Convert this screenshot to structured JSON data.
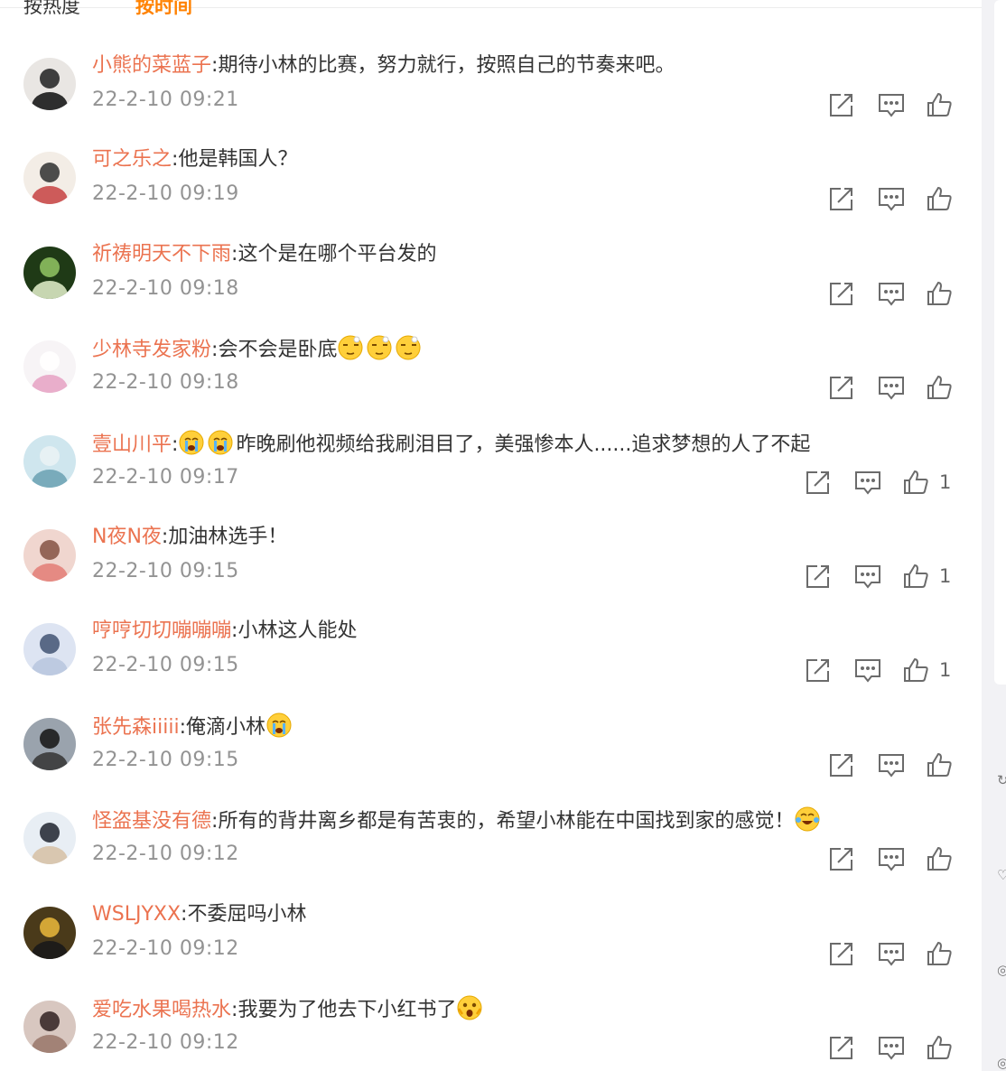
{
  "sort": {
    "hot_label": "按热度",
    "time_label": "按时间"
  },
  "comments": [
    {
      "user": "小熊的菜蓝子",
      "text": "期待小林的比赛，努力就行，按照自己的节奏来吧。",
      "emojis": [],
      "time": "22-2-10 09:21",
      "likes": ""
    },
    {
      "user": "可之乐之",
      "text": "他是韩国人？",
      "emojis": [],
      "time": "22-2-10 09:19",
      "likes": ""
    },
    {
      "user": "祈祷明天不下雨",
      "text": "这个是在哪个平台发的",
      "emojis": [],
      "time": "22-2-10 09:18",
      "likes": ""
    },
    {
      "user": "少林寺发家粉",
      "text": "会不会是卧底",
      "emojis": [
        "dizzy-face",
        "dizzy-face",
        "dizzy-face"
      ],
      "time": "22-2-10 09:18",
      "likes": ""
    },
    {
      "user": "壹山川平",
      "text_before": "",
      "emojis_before": [
        "crying-face",
        "crying-face"
      ],
      "text": "昨晚刷他视频给我刷泪目了，美强惨本人......追求梦想的人了不起",
      "emojis": [],
      "time": "22-2-10 09:17",
      "likes": "1"
    },
    {
      "user": "N夜N夜",
      "text": "加油林选手！",
      "emojis": [],
      "time": "22-2-10 09:15",
      "likes": "1"
    },
    {
      "user": "哼哼切切嘣嘣嘣",
      "text": "小林这人能处",
      "emojis": [],
      "time": "22-2-10 09:15",
      "likes": "1"
    },
    {
      "user": "张先森iiiii",
      "text": "俺滴小林",
      "emojis": [
        "crying-face"
      ],
      "time": "22-2-10 09:15",
      "likes": ""
    },
    {
      "user": "怪盗基没有德",
      "text": "所有的背井离乡都是有苦衷的，希望小林能在中国找到家的感觉！",
      "emojis": [
        "tears-of-joy-face"
      ],
      "time": "22-2-10 09:12",
      "likes": ""
    },
    {
      "user": "WSLJYXX",
      "text": "不委屈吗小林",
      "emojis": [],
      "time": "22-2-10 09:12",
      "likes": ""
    },
    {
      "user": "爱吃水果喝热水",
      "text": "我要为了他去下小红书了",
      "emojis": [
        "screaming-face"
      ],
      "time": "22-2-10 09:12",
      "likes": ""
    }
  ],
  "icons": {
    "share": "share-icon",
    "comment": "comment-icon",
    "like": "like-icon"
  },
  "colors": {
    "username": "#eb7350",
    "active_tab": "#ff8200",
    "timestamp": "#939393",
    "text": "#333333",
    "icon": "#6b6b6b"
  }
}
